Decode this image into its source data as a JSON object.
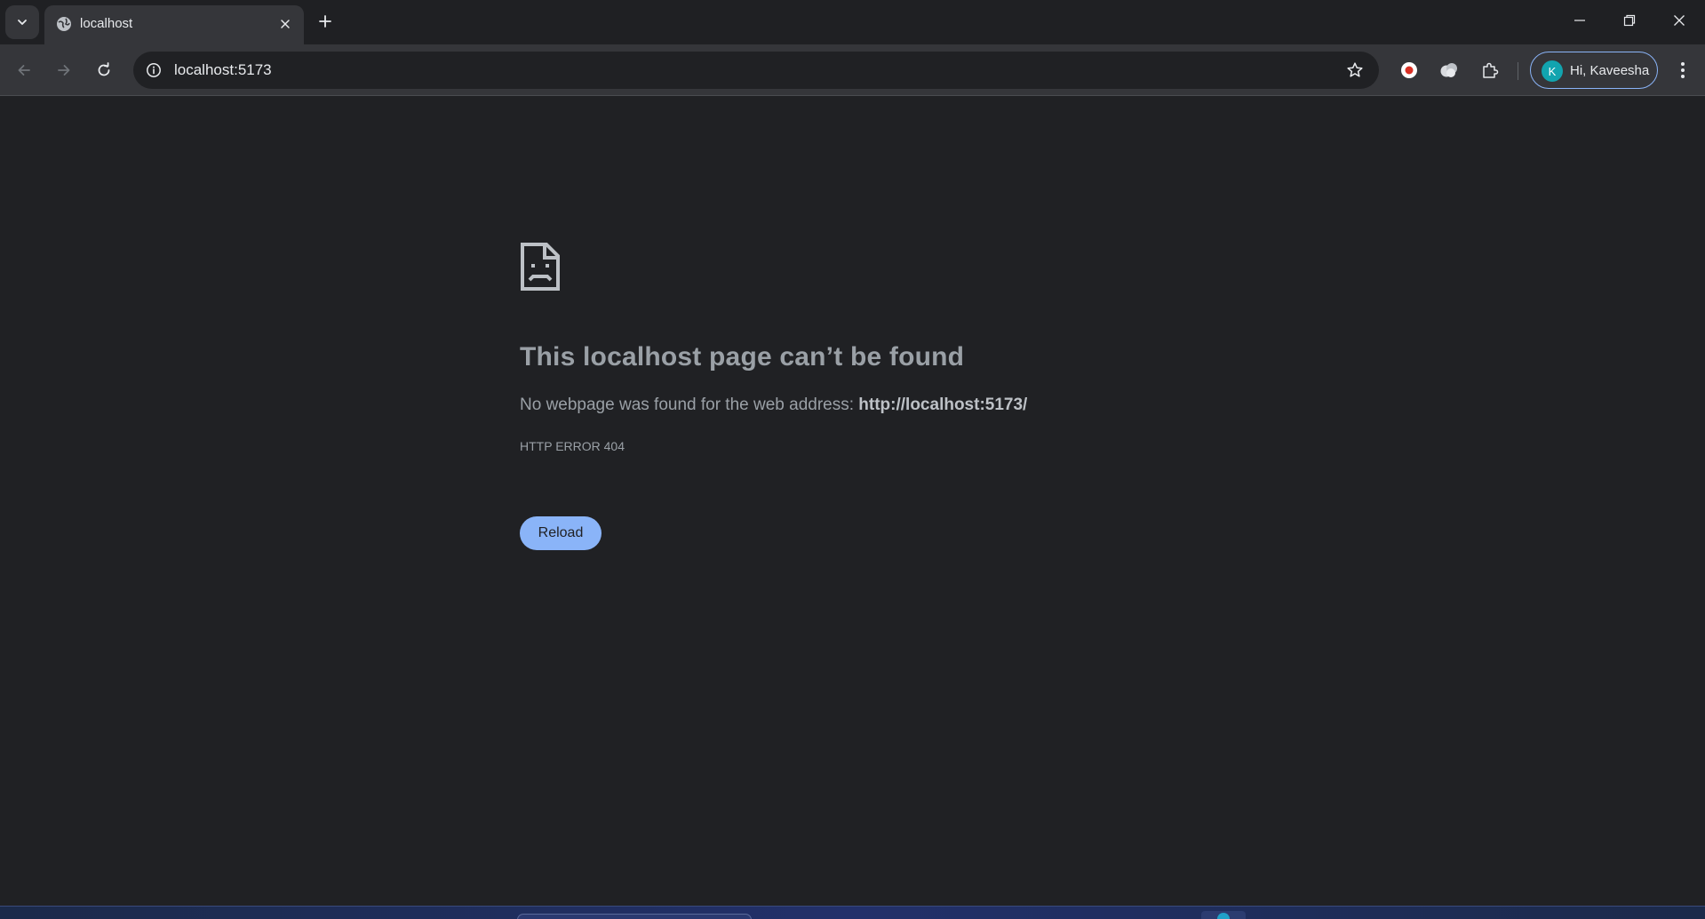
{
  "browser": {
    "tab": {
      "title": "localhost",
      "favicon": "globe-icon"
    },
    "address_bar": {
      "url": "localhost:5173"
    },
    "profile": {
      "initial": "K",
      "greeting": "Hi, Kaveesha",
      "avatar_color": "#12a4af"
    },
    "accent_color": "#8ab4f8"
  },
  "page": {
    "icon": "sad-document-icon",
    "title": "This localhost page can’t be found",
    "description_prefix": "No webpage was found for the web address: ",
    "description_url": "http://localhost:5173/",
    "error_code": "HTTP ERROR 404",
    "reload_label": "Reload"
  }
}
